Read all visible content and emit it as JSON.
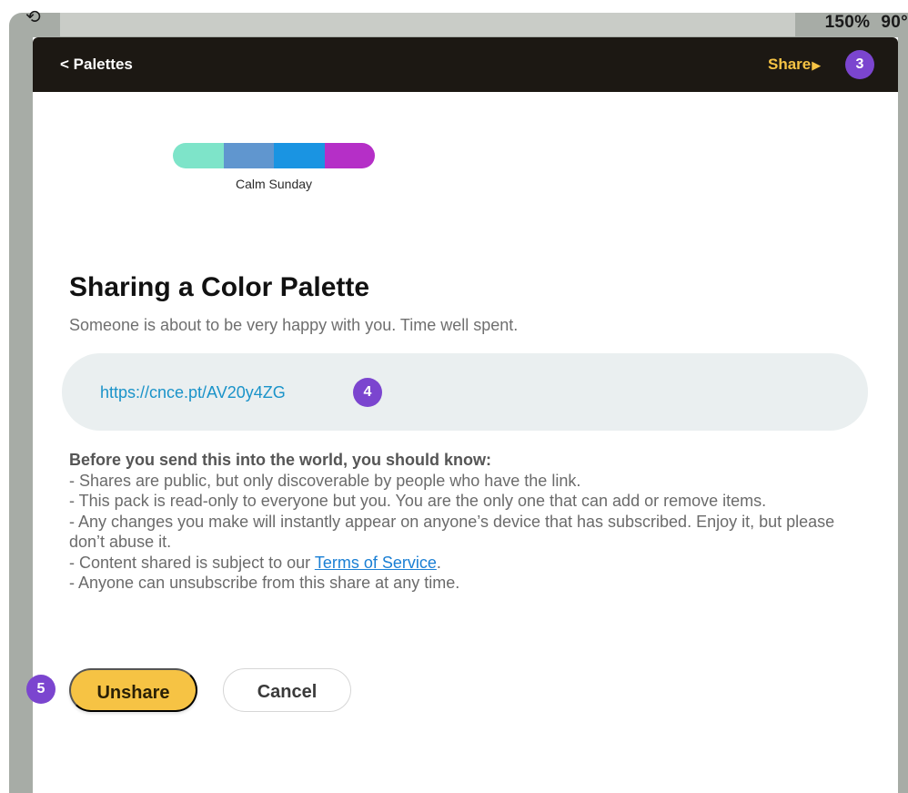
{
  "status_bar": {
    "icon": "rotation-lock-icon",
    "zoom": "150%",
    "rotation": "90°"
  },
  "nav": {
    "back_label": "< Palettes",
    "share_label": "Share",
    "share_arrow": "▶",
    "share_step": "3"
  },
  "palette": {
    "name": "Calm Sunday",
    "colors": [
      "#7ee4c9",
      "#6096cf",
      "#1a94e2",
      "#b52fc7"
    ]
  },
  "content": {
    "title": "Sharing a Color Palette",
    "subtitle": "Someone is about to be very happy with you. Time well spent.",
    "share_url": "https://cnce.pt/AV20y4ZG",
    "url_step": "4",
    "notice_heading": "Before you send this into the world, you should know:",
    "notices": [
      "- Shares are public, but only discoverable by people who have the link.",
      "- This pack is read-only to everyone but you. You are the only one that can add or remove items.",
      "- Any changes you make will instantly appear on anyone’s device that has subscribed. Enjoy it, but please don’t abuse it.",
      "- Content shared is subject to our ",
      "- Anyone can unsubscribe from this share at any time."
    ],
    "terms_link": "Terms of Service",
    "terms_suffix": "."
  },
  "actions": {
    "unshare_label": "Unshare",
    "unshare_step": "5",
    "cancel_label": "Cancel"
  },
  "colors": {
    "accent_yellow": "#f6c344",
    "badge_purple": "#7b45cf",
    "nav_dark": "#1c1813",
    "link_blue": "#1a93c9"
  }
}
